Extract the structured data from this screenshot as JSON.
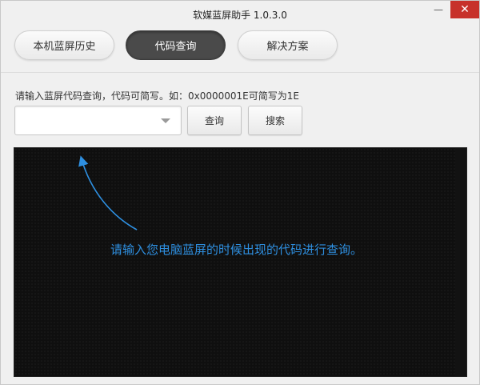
{
  "window": {
    "title": "软媒蓝屏助手 1.0.3.0",
    "minimize_glyph": "—",
    "close_glyph": "✕"
  },
  "tabs": [
    {
      "label": "本机蓝屏历史",
      "active": false
    },
    {
      "label": "代码查询",
      "active": true
    },
    {
      "label": "解决方案",
      "active": false
    }
  ],
  "query": {
    "hint": "请输入蓝屏代码查询，代码可简写。如：0x0000001E可简写为1E",
    "input_value": "",
    "query_button": "查询",
    "search_button": "搜索"
  },
  "panel": {
    "message": "请输入您电脑蓝屏的时候出现的代码进行查询。",
    "message_color": "#2e8fe0",
    "arrow_icon": "curved-arrow-up"
  }
}
